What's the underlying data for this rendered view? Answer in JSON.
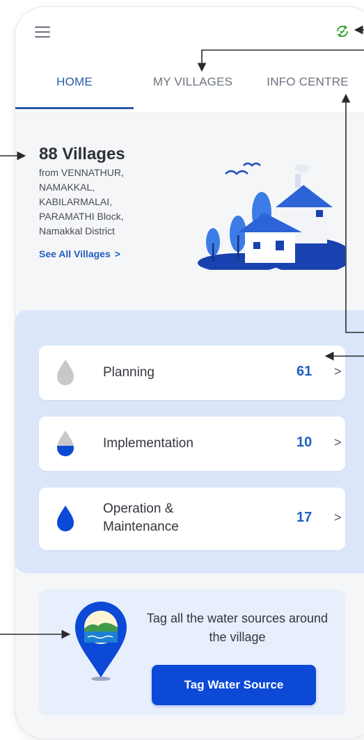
{
  "header": {
    "menu_icon": "hamburger-icon",
    "sync_icon": "sync-icon",
    "accent_color": "#2a5aa8"
  },
  "tabs": [
    {
      "label": "HOME",
      "active": true
    },
    {
      "label": "MY VILLAGES",
      "active": false
    },
    {
      "label": "INFO CENTRE",
      "active": false
    }
  ],
  "summary": {
    "title": "88 Villages",
    "origin": "from VENNATHUR, NAMAKKAL, KABILARMALAI, PARAMATHI Block, Namakkal District",
    "see_all": "See All Villages",
    "see_all_chevron": ">"
  },
  "stages": [
    {
      "label": "Planning",
      "count": "61",
      "icon": "water-drop-empty-icon",
      "fill": 0
    },
    {
      "label": "Implementation",
      "count": "10",
      "icon": "water-drop-half-icon",
      "fill": 0.5
    },
    {
      "label": "Operation & Maintenance",
      "count": "17",
      "icon": "water-drop-full-icon",
      "fill": 1
    }
  ],
  "stage_chevron": ">",
  "tag_water": {
    "text": "Tag all the water sources around the village",
    "button": "Tag Water Source",
    "icon": "location-pin-icon",
    "button_color": "#0b49d6"
  }
}
